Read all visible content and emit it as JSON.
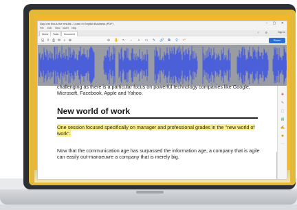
{
  "window": {
    "title": "Day one focus live results - Learn in English Business (PDF)",
    "controls": "– ▢ ✕"
  },
  "menubar": [
    "File",
    "Edit",
    "View",
    "Insert",
    "Help"
  ],
  "tabs": [
    "Home",
    "Tools",
    "Document"
  ],
  "tabbar_right": {
    "icons": "? ⚙",
    "signin": "Sign in"
  },
  "toolbar": {
    "icons": [
      {
        "name": "save-icon",
        "glyph": "🖫"
      },
      {
        "name": "upload-icon",
        "glyph": "⇪"
      },
      {
        "name": "print-icon",
        "glyph": "⎙"
      },
      {
        "name": "mail-icon",
        "glyph": "✉"
      },
      {
        "name": "search-icon",
        "glyph": "⌕"
      },
      {
        "name": "up-icon",
        "glyph": "⊕"
      },
      {
        "name": "down-icon",
        "glyph": "⊖"
      },
      {
        "name": "hand-icon",
        "glyph": "✋"
      },
      {
        "name": "cursor-icon",
        "glyph": "↖"
      },
      {
        "name": "zoom-out-icon",
        "glyph": "−"
      },
      {
        "name": "zoom-in-icon",
        "glyph": "+"
      },
      {
        "name": "comment-icon",
        "glyph": "▭"
      },
      {
        "name": "pen-icon",
        "glyph": "✎"
      },
      {
        "name": "link-icon",
        "glyph": "🔗"
      },
      {
        "name": "attach-icon",
        "glyph": "⧉"
      },
      {
        "name": "stamp-icon",
        "glyph": "⚲"
      },
      {
        "name": "undo-icon",
        "glyph": "↶"
      }
    ],
    "share_label": "Share"
  },
  "document": {
    "cut_line": "challenging as there is a particular focus on powerful technology companies like Google, Microsoft, Facebook, Apple and Yahoo.",
    "heading": "New world of work",
    "highlight": "One session focused specifically on manager and professional grades in the \"new world of work\".",
    "paragraph": "Now that the communication age has surpassed the information age, a company that is agile can easily out-manoeuvre a company that is merely big."
  },
  "side_icons": [
    {
      "name": "comment-side-icon",
      "glyph": "✚",
      "color": "#d84c4c"
    },
    {
      "name": "edit-side-icon",
      "glyph": "✎",
      "color": "#c94fb5"
    },
    {
      "name": "export-side-icon",
      "glyph": "⬚",
      "color": "#3e78d8"
    },
    {
      "name": "organize-side-icon",
      "glyph": "▤",
      "color": "#2f9e5b"
    },
    {
      "name": "fill-sign-icon",
      "glyph": "✍",
      "color": "#6a55c8"
    },
    {
      "name": "protect-icon",
      "glyph": "◆",
      "color": "#e2a31c"
    },
    {
      "name": "more-tools-icon",
      "glyph": "⋯",
      "color": "#2d9e3f"
    }
  ],
  "colors": {
    "waveform": "#4a5fd8",
    "highlight": "#fbf08a",
    "screen_frame": "#f2b72c",
    "accent": "#2b6fd6"
  }
}
